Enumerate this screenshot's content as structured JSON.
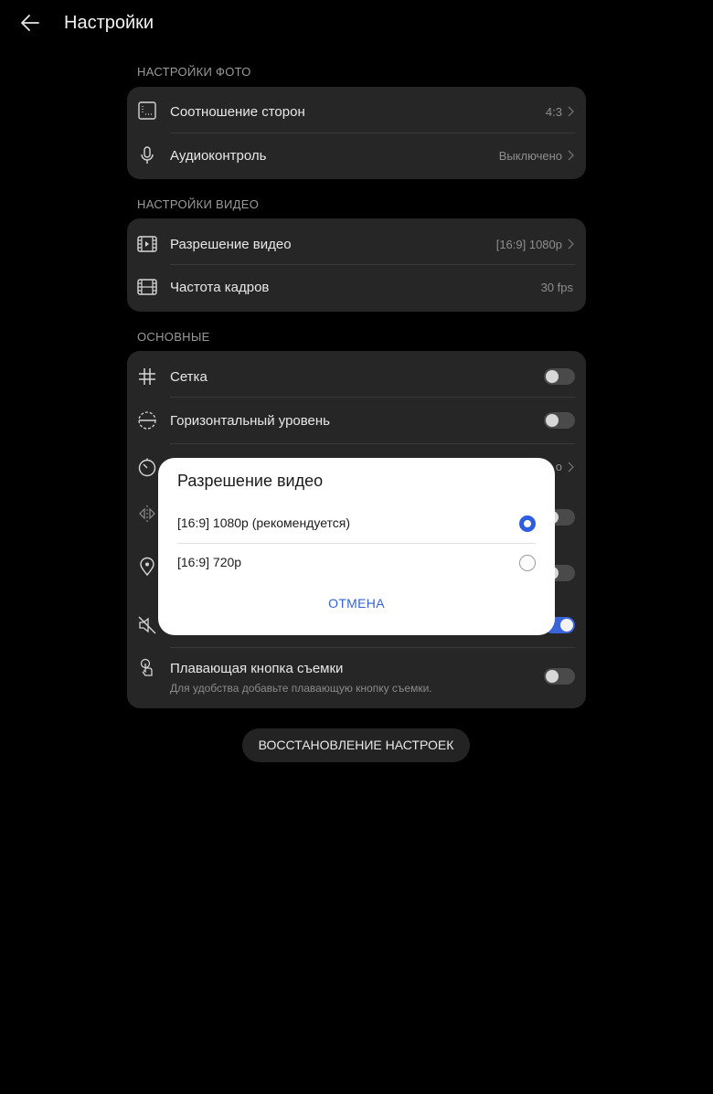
{
  "header": {
    "title": "Настройки"
  },
  "photo_section": {
    "label": "НАСТРОЙКИ ФОТО",
    "rows": [
      {
        "label": "Соотношение сторон",
        "value": "4:3",
        "icon": "aspect-ratio-icon"
      },
      {
        "label": "Аудиоконтроль",
        "value": "Выключено",
        "icon": "microphone-icon"
      }
    ]
  },
  "video_section": {
    "label": "НАСТРОЙКИ ВИДЕО",
    "rows": [
      {
        "label": "Разрешение видео",
        "value": "[16:9] 1080p",
        "icon": "video-resolution-icon"
      },
      {
        "label": "Частота кадров",
        "value": "30 fps",
        "icon": "film-frame-icon"
      }
    ]
  },
  "general_section": {
    "label": "ОСНОВНЫЕ",
    "rows": [
      {
        "label": "Сетка",
        "toggle": false,
        "icon": "grid-icon"
      },
      {
        "label": "Горизонтальный уровень",
        "toggle": false,
        "icon": "horizon-level-icon"
      },
      {
        "partial_value": "o",
        "icon": "timer-icon"
      },
      {
        "toggle": false,
        "icon": "mirror-icon"
      },
      {
        "toggle": false,
        "icon": "location-pin-icon"
      },
      {
        "toggle": true,
        "icon": "mute-icon"
      },
      {
        "label": "Плавающая кнопка съемки",
        "sub": "Для удобства добавьте плавающую кнопку съемки.",
        "toggle": false,
        "icon": "floating-shutter-icon"
      }
    ]
  },
  "reset_button": {
    "label": "ВОССТАНОВЛЕНИЕ НАСТРОЕК"
  },
  "dialog": {
    "title": "Разрешение видео",
    "options": [
      {
        "label": "[16:9] 1080p (рекомендуется)",
        "selected": true
      },
      {
        "label": "[16:9] 720p",
        "selected": false
      }
    ],
    "cancel_label": "ОТМЕНА"
  },
  "colors": {
    "accent": "#3462d6",
    "toggle_on": "#3a64d8",
    "card_bg": "#262626",
    "background": "#000000"
  }
}
